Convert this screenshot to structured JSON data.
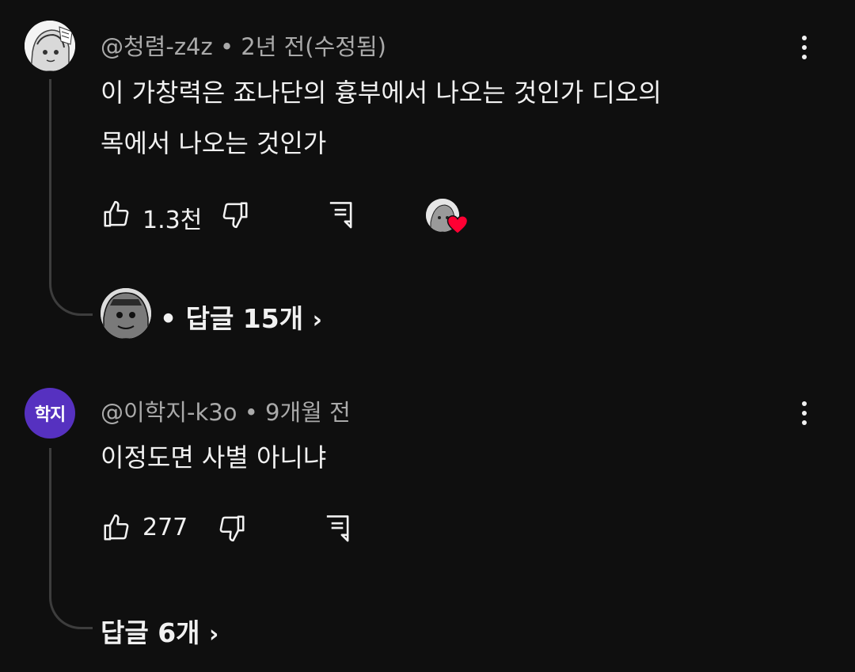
{
  "comments": [
    {
      "author": "@청렴-z4z",
      "age": "2년 전(수정됨)",
      "text_line1": "이 가창력은 죠나단의 흉부에서 나오는 것인가 디오의",
      "text_line2": "목에서 나오는 것인가",
      "likes": "1.3천",
      "replies_label": "답글 15개",
      "hearted": true
    },
    {
      "author": "@이학지-k3o",
      "age": "9개월 전",
      "avatar_text": "학지",
      "avatar_color": "#5631c0",
      "text": "이정도면 사별 아니냐",
      "likes": "277",
      "replies_label": "답글 6개"
    }
  ],
  "separator": "•",
  "chevron": "›",
  "colors": {
    "background": "#0f0f0f",
    "text": "#f1f1f1",
    "meta": "#aaaaaa",
    "heart": "#ff0033"
  }
}
